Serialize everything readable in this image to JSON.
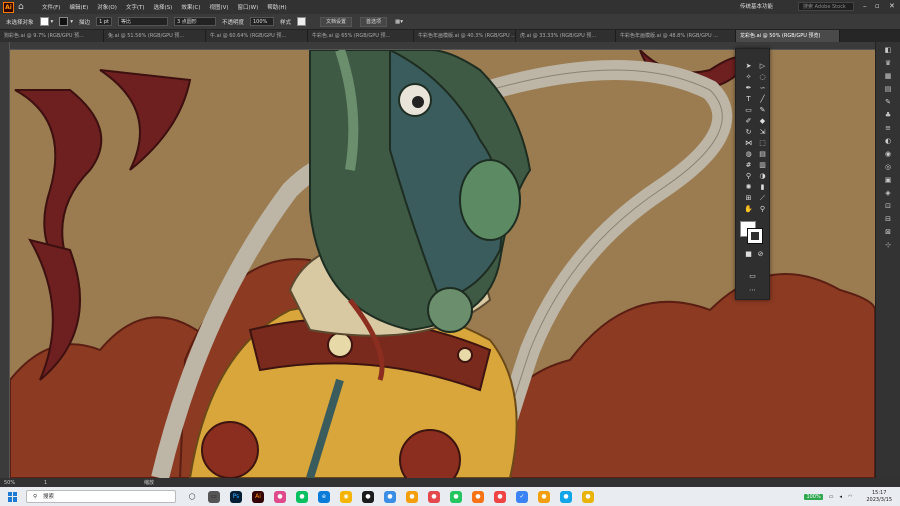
{
  "menubar": {
    "logo": "Ai",
    "items": [
      "文件(F)",
      "编辑(E)",
      "对象(O)",
      "文字(T)",
      "选择(S)",
      "效果(C)",
      "视图(V)",
      "窗口(W)",
      "帮助(H)"
    ],
    "workspace": "传统基本功能",
    "search_placeholder": "搜索 Adobe Stock"
  },
  "control_bar": {
    "selection": "未选择对象",
    "stroke_label": "描边",
    "stroke_value": "1 pt",
    "brush_label": "等比",
    "points": "3 点圆形",
    "opacity_label": "不透明度",
    "opacity_value": "100%",
    "style_label": "样式",
    "doc_setup": "文档设置",
    "preferences": "首选项"
  },
  "tabs": [
    {
      "label": "狗彩色.ai @ 9.7% (RGB/GPU 预..."
    },
    {
      "label": "兔.ai @ 51.56% (RGB/GPU 预..."
    },
    {
      "label": "牛.ai @ 60.64% (RGB/GPU 预..."
    },
    {
      "label": "牛彩色.ai @ 65% (RGB/GPU 预..."
    },
    {
      "label": "牛彩色年画模版.ai @ 40.3% (RGB/GPU ..."
    },
    {
      "label": "虎.ai @ 33.33% (RGB/GPU 预..."
    },
    {
      "label": "牛彩色年画模版.ai @ 48.8% (RGB/GPU ..."
    },
    {
      "label": "龙彩色.ai @ 50% (RGB/GPU 预览)"
    }
  ],
  "status": {
    "zoom": "50%",
    "artboard": "1",
    "tool_name": "缩放"
  },
  "taskbar": {
    "search_placeholder": "搜索",
    "battery": "100%",
    "time": "15:17",
    "date": "2023/3/15"
  },
  "colors": {
    "canvas_bg": "#9b7c51",
    "cloud_red": "#8c3a22",
    "dark_red": "#6e1f1f",
    "dragon_green": "#3e5a44",
    "dragon_teal": "#3b5c5c",
    "gold": "#d8a63a",
    "scarf_grey": "#bdb5a6"
  }
}
